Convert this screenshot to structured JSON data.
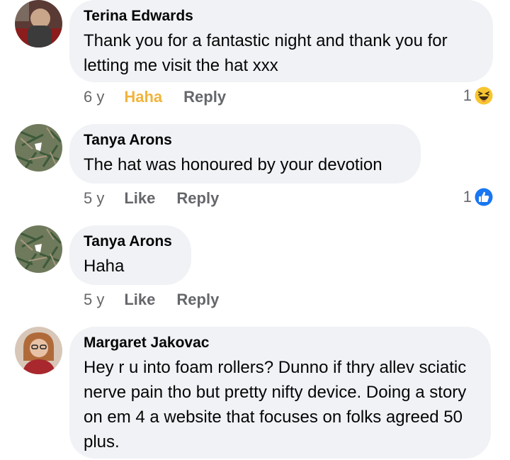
{
  "comments": [
    {
      "author": "Terina Edwards",
      "text": "Thank you for a fantastic night and thank you for letting me visit the hat xxx",
      "time": "6 y",
      "like_label": "Haha",
      "reply_label": "Reply",
      "reaction_count": "1",
      "reaction_icon": "haha-emoji-icon"
    },
    {
      "author": "Tanya Arons",
      "text": "The hat was honoured by your devotion",
      "time": "5 y",
      "like_label": "Like",
      "reply_label": "Reply",
      "reaction_count": "1",
      "reaction_icon": "like-thumb-icon"
    },
    {
      "author": "Tanya Arons",
      "text": "Haha",
      "time": "5 y",
      "like_label": "Like",
      "reply_label": "Reply"
    },
    {
      "author": "Margaret Jakovac",
      "text": "Hey r u into foam rollers? Dunno if thry allev sciatic nerve pain tho but pretty nifty device. Doing a story on em 4 a website that focuses on folks agreed 50 plus."
    }
  ],
  "colors": {
    "bubble": "#f0f2f5",
    "meta": "#65676b",
    "haha": "#f0b43c",
    "like_blue": "#1877f2"
  }
}
